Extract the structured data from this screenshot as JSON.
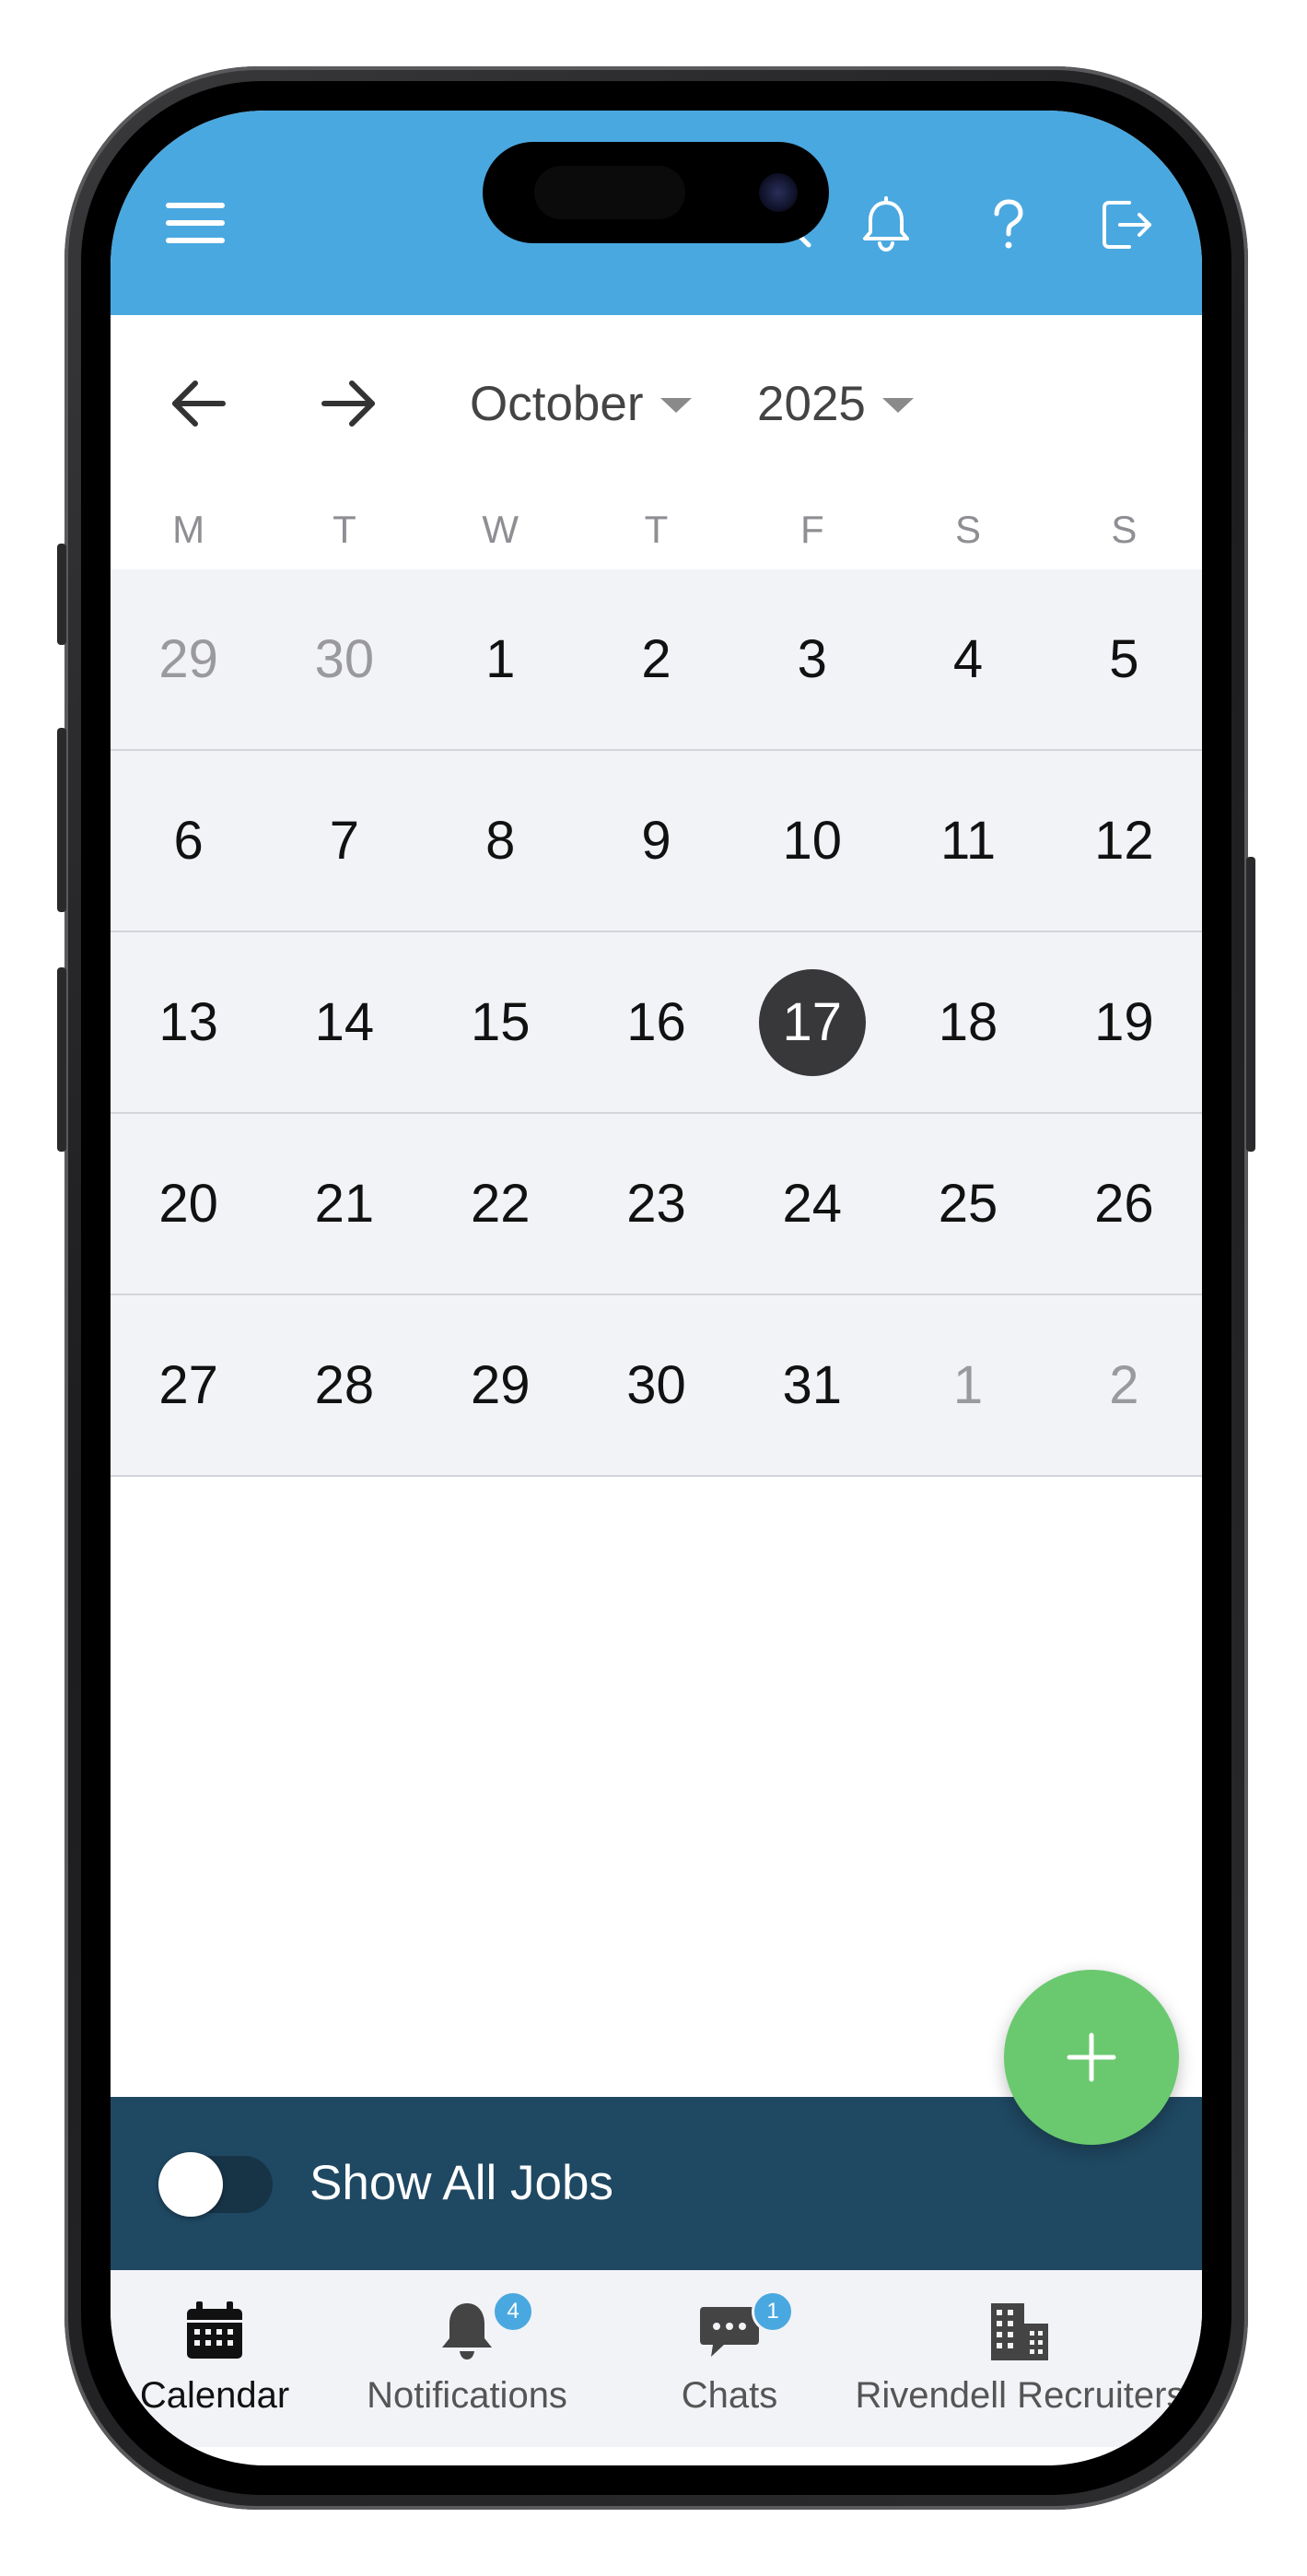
{
  "header": {
    "menu_icon": "hamburger-icon",
    "icons": [
      "search-icon",
      "bell-icon",
      "help-icon",
      "logout-icon"
    ],
    "color": "#4aa8e0"
  },
  "calendar": {
    "month": "October",
    "year": "2025",
    "weekdays": [
      "M",
      "T",
      "W",
      "T",
      "F",
      "S",
      "S"
    ],
    "weeks": [
      [
        {
          "d": "29",
          "muted": true
        },
        {
          "d": "30",
          "muted": true
        },
        {
          "d": "1"
        },
        {
          "d": "2"
        },
        {
          "d": "3"
        },
        {
          "d": "4"
        },
        {
          "d": "5"
        }
      ],
      [
        {
          "d": "6"
        },
        {
          "d": "7"
        },
        {
          "d": "8"
        },
        {
          "d": "9"
        },
        {
          "d": "10"
        },
        {
          "d": "11"
        },
        {
          "d": "12"
        }
      ],
      [
        {
          "d": "13"
        },
        {
          "d": "14"
        },
        {
          "d": "15"
        },
        {
          "d": "16"
        },
        {
          "d": "17",
          "today": true
        },
        {
          "d": "18"
        },
        {
          "d": "19"
        }
      ],
      [
        {
          "d": "20"
        },
        {
          "d": "21"
        },
        {
          "d": "22"
        },
        {
          "d": "23"
        },
        {
          "d": "24"
        },
        {
          "d": "25"
        },
        {
          "d": "26"
        }
      ],
      [
        {
          "d": "27"
        },
        {
          "d": "28"
        },
        {
          "d": "29"
        },
        {
          "d": "30"
        },
        {
          "d": "31"
        },
        {
          "d": "1",
          "muted": true
        },
        {
          "d": "2",
          "muted": true
        }
      ]
    ]
  },
  "jobs_bar": {
    "label": "Show All Jobs",
    "toggle_on": false,
    "color": "#1f4862"
  },
  "fab": {
    "icon": "plus-icon",
    "color": "#6ac96e"
  },
  "tabbar": {
    "tabs": [
      {
        "label": "Calendar",
        "icon": "calendar-icon",
        "active": true
      },
      {
        "label": "Notifications",
        "icon": "bell-icon",
        "badge": "4"
      },
      {
        "label": "Chats",
        "icon": "chat-icon",
        "badge": "1"
      },
      {
        "label": "Rivendell Recruiters",
        "icon": "building-icon"
      }
    ]
  }
}
